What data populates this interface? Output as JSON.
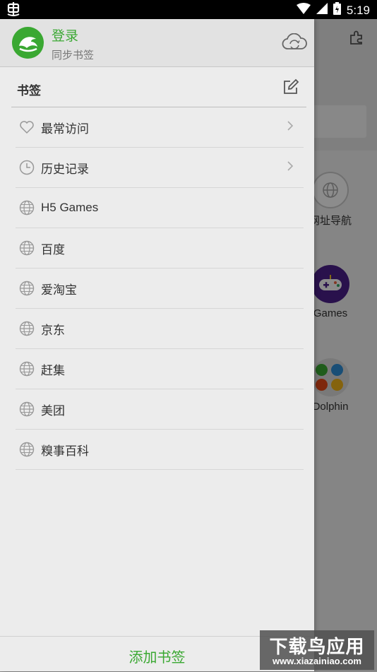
{
  "status_bar": {
    "time": "5:19"
  },
  "background": {
    "tiles": [
      {
        "label": "网址导航"
      },
      {
        "label": "Games"
      },
      {
        "label": "Dolphin"
      }
    ]
  },
  "drawer": {
    "header": {
      "title": "登录",
      "subtitle": "同步书签"
    },
    "section": {
      "title": "书签"
    },
    "items": [
      {
        "label": "最常访问",
        "icon": "heart-icon",
        "chevron": true
      },
      {
        "label": "历史记录",
        "icon": "clock-icon",
        "chevron": true
      },
      {
        "label": "H5 Games",
        "icon": "globe-icon"
      },
      {
        "label": "百度",
        "icon": "globe-icon"
      },
      {
        "label": "爱淘宝",
        "icon": "globe-icon"
      },
      {
        "label": "京东",
        "icon": "globe-icon"
      },
      {
        "label": "赶集",
        "icon": "globe-icon"
      },
      {
        "label": "美团",
        "icon": "globe-icon"
      },
      {
        "label": "糗事百科",
        "icon": "globe-icon"
      }
    ],
    "add_button": "添加书签"
  },
  "watermark": {
    "main": "下载鸟应用",
    "sub": "www.xiazainiao.com"
  },
  "colors": {
    "accent": "#3aa832"
  }
}
